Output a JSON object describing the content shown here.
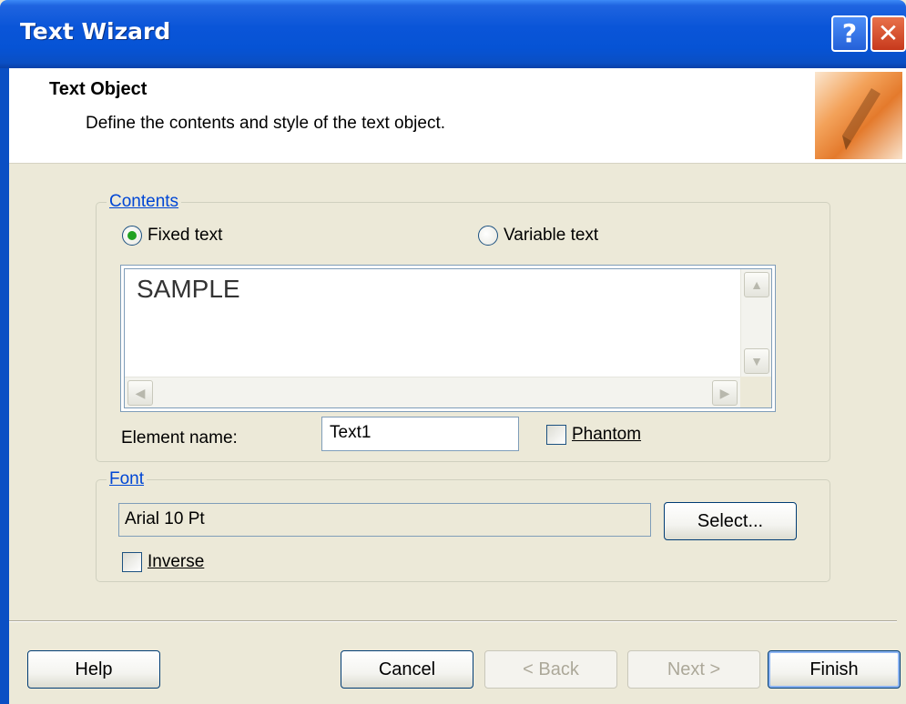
{
  "window": {
    "title": "Text Wizard",
    "help_glyph": "?",
    "close_glyph": "✕"
  },
  "header": {
    "title": "Text Object",
    "description": "Define the contents and style of the text object."
  },
  "contents": {
    "legend": "Contents",
    "radio_fixed": "Fixed text",
    "radio_variable": "Variable text",
    "selected": "Fixed text",
    "text_value": "SAMPLE",
    "element_name_label": "Element name:",
    "element_name_value": "Text1",
    "phantom_label": "Phantom"
  },
  "font": {
    "legend": "Font",
    "value": "Arial 10 Pt",
    "select_label": "Select...",
    "inverse_label": "Inverse"
  },
  "footer": {
    "help": "Help",
    "cancel": "Cancel",
    "back": "< Back",
    "next": "Next >",
    "finish": "Finish"
  }
}
